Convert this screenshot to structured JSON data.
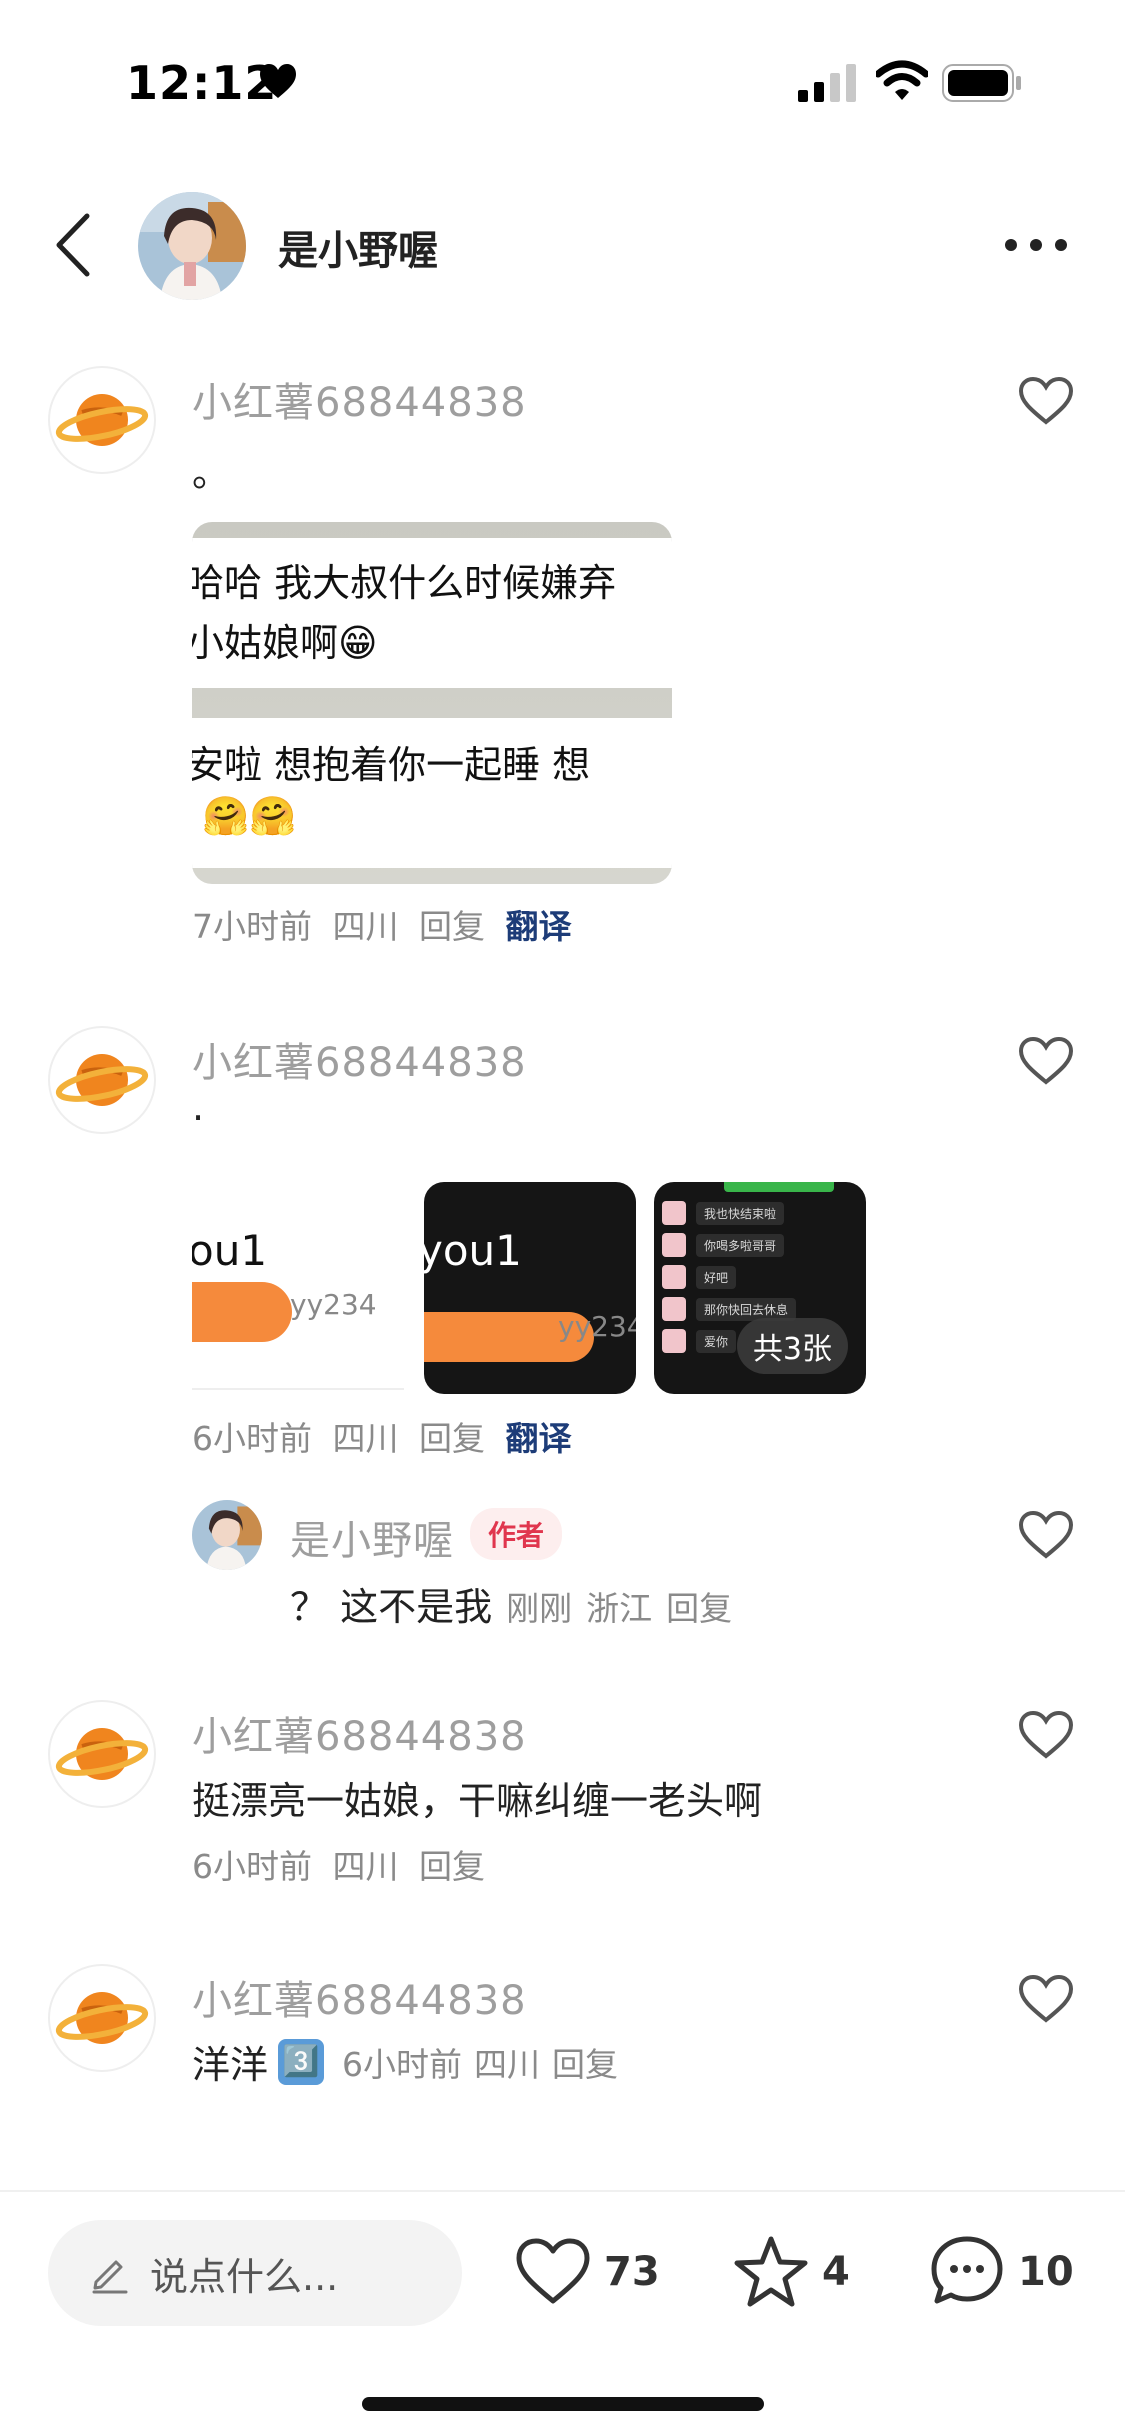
{
  "status_bar": {
    "time": "12:12"
  },
  "header": {
    "name": "是小野喔"
  },
  "comments": [
    {
      "user": "小红薯68844838",
      "text": "。",
      "image_lines": [
        "哈哈 我大叔什么时候嫌弃",
        "小姑娘啊😁",
        "安啦 想抱着你一起睡 想",
        "🤗🤗"
      ],
      "time": "7小时前",
      "location": "四川",
      "reply": "回复",
      "translate": "翻译"
    },
    {
      "user": "小红薯68844838",
      "text": "·",
      "image1": {
        "big": "ou1",
        "small": "yy234"
      },
      "image2": {
        "big": "you1",
        "small": "yy234"
      },
      "image3": {
        "chats": [
          "我也快结束啦",
          "你喝多啦哥哥",
          "好吧",
          "那你快回去休息",
          "爱你"
        ],
        "badge": "共3张"
      },
      "time": "6小时前",
      "location": "四川",
      "reply": "回复",
      "translate": "翻译",
      "sub_reply": {
        "user": "是小野喔",
        "badge": "作者",
        "text": "？ 这不是我",
        "time": "刚刚",
        "location": "浙江",
        "reply": "回复"
      }
    },
    {
      "user": "小红薯68844838",
      "text": "挺漂亮一姑娘，干嘛纠缠一老头啊",
      "time": "6小时前",
      "location": "四川",
      "reply": "回复"
    },
    {
      "user": "小红薯68844838",
      "text": "洋洋",
      "emoji": "3️⃣",
      "time": "6小时前",
      "location": "四川",
      "reply": "回复"
    }
  ],
  "bottom_bar": {
    "placeholder": "说点什么...",
    "likes": "73",
    "stars": "4",
    "comments": "10"
  }
}
